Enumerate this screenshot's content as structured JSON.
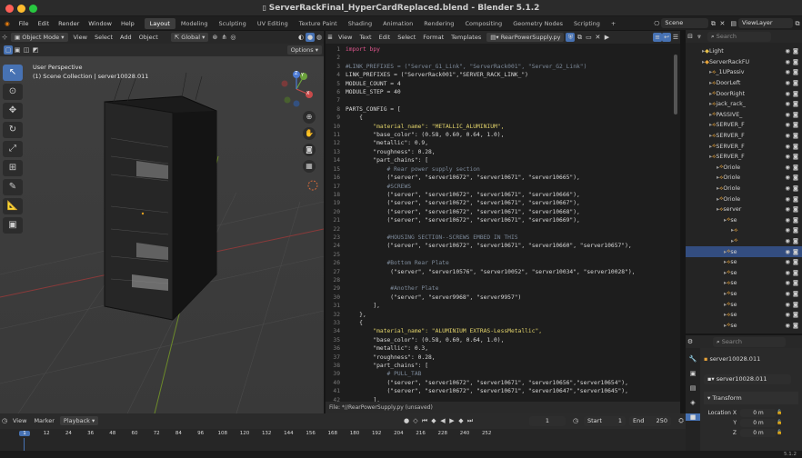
{
  "window": {
    "title": "ServerRackFinal_HyperCardReplaced.blend - Blender 5.1.2"
  },
  "menu": [
    "File",
    "Edit",
    "Render",
    "Window",
    "Help"
  ],
  "workspaces": [
    "Layout",
    "Modeling",
    "Sculpting",
    "UV Editing",
    "Texture Paint",
    "Shading",
    "Animation",
    "Rendering",
    "Compositing",
    "Geometry Nodes",
    "Scripting"
  ],
  "workspace_add": "+",
  "scene": {
    "name": "Scene",
    "view_layer": "ViewLayer"
  },
  "viewport": {
    "mode": "Object Mode",
    "menus": [
      "View",
      "Select",
      "Add",
      "Object"
    ],
    "orientation": "Global",
    "options": "Options",
    "info_line1": "User Perspective",
    "info_line2": "(1) Scene Collection | server10028.011",
    "gizmo": {
      "x": "X",
      "y": "Y",
      "z": "Z"
    }
  },
  "text_editor": {
    "menus": [
      "View",
      "Text",
      "Edit",
      "Select",
      "Format",
      "Templates"
    ],
    "filename": "RearPowerSupply.py",
    "status": "File: *//RearPowerSupply.py (unsaved)",
    "lines": [
      {
        "n": "1",
        "t": "import bpy"
      },
      {
        "n": "2",
        "t": ""
      },
      {
        "n": "3",
        "t": "#LINK_PREFIXES = (\"Server_G1_Link\", \"ServerRack001\", \"Server_G2_Link\")"
      },
      {
        "n": "4",
        "t": "LINK_PREFIXES = (\"ServerRack001\",\"SERVER_RACK_LINK_\")"
      },
      {
        "n": "5",
        "t": "MODULE_COUNT = 4"
      },
      {
        "n": "6",
        "t": "MODULE_STEP = 40"
      },
      {
        "n": "7",
        "t": ""
      },
      {
        "n": "8",
        "t": "PARTS_CONFIG = ["
      },
      {
        "n": "9",
        "t": "    {"
      },
      {
        "n": "10",
        "t": "        \"material_name\": \"METALLIC_ALUMINIUM\","
      },
      {
        "n": "11",
        "t": "        \"base_color\": (0.58, 0.60, 0.64, 1.0),"
      },
      {
        "n": "12",
        "t": "        \"metallic\": 0.9,"
      },
      {
        "n": "13",
        "t": "        \"roughness\": 0.28,"
      },
      {
        "n": "14",
        "t": "        \"part_chains\": ["
      },
      {
        "n": "15",
        "t": "            # Rear power supply section"
      },
      {
        "n": "16",
        "t": "            (\"server\", \"server10672\", \"server10671\", \"server10665\"),"
      },
      {
        "n": "17",
        "t": "            #SCREWS"
      },
      {
        "n": "18",
        "t": "            (\"server\", \"server10672\", \"server10671\", \"server10666\"),"
      },
      {
        "n": "19",
        "t": "            (\"server\", \"server10672\", \"server10671\", \"server10667\"),"
      },
      {
        "n": "20",
        "t": "            (\"server\", \"server10672\", \"server10671\", \"server10668\"),"
      },
      {
        "n": "21",
        "t": "            (\"server\", \"server10672\", \"server10671\", \"server10669\"),"
      },
      {
        "n": "22",
        "t": ""
      },
      {
        "n": "23",
        "t": "            #HOUSING SECTION--SCREWS EMBED IN THIS"
      },
      {
        "n": "24",
        "t": "            (\"server\", \"server10672\", \"server10671\", \"server10660\", \"server10657\"),"
      },
      {
        "n": "25",
        "t": ""
      },
      {
        "n": "26",
        "t": "            #Bottom Rear Plate"
      },
      {
        "n": "27",
        "t": "             (\"server\", \"server10576\", \"server10052\", \"server10034\", \"server10028\"),"
      },
      {
        "n": "28",
        "t": ""
      },
      {
        "n": "29",
        "t": "             #Another Plate"
      },
      {
        "n": "30",
        "t": "             (\"server\", \"server9968\", \"server9957\")"
      },
      {
        "n": "31",
        "t": "        ],"
      },
      {
        "n": "32",
        "t": "    },"
      },
      {
        "n": "33",
        "t": "    {"
      },
      {
        "n": "34",
        "t": "        \"material_name\": \"ALUMINIUM EXTRAS-LessMetallic\","
      },
      {
        "n": "35",
        "t": "        \"base_color\": (0.58, 0.60, 0.64, 1.0),"
      },
      {
        "n": "36",
        "t": "        \"metallic\": 0.3,"
      },
      {
        "n": "37",
        "t": "        \"roughness\": 0.28,"
      },
      {
        "n": "38",
        "t": "        \"part_chains\": ["
      },
      {
        "n": "39",
        "t": "            # PULL_TAB"
      },
      {
        "n": "40",
        "t": "            (\"server\", \"server10672\", \"server10671\", \"server10656\",\"server10654\"),"
      },
      {
        "n": "41",
        "t": "            (\"server\", \"server10672\", \"server10671\", \"server10647\",\"server10645\"),"
      },
      {
        "n": "42",
        "t": "        ],"
      },
      {
        "n": "43",
        "t": "    },"
      }
    ]
  },
  "outliner": {
    "search_placeholder": "Search",
    "items": [
      {
        "label": "Light",
        "indent": 1
      },
      {
        "label": "ServerRackFU",
        "indent": 1
      },
      {
        "label": "_1UPassiv",
        "indent": 2
      },
      {
        "label": "DoorLeft",
        "indent": 2
      },
      {
        "label": "DoorRight",
        "indent": 2
      },
      {
        "label": "jack_rack_",
        "indent": 2
      },
      {
        "label": "PASSIVE_",
        "indent": 2
      },
      {
        "label": "SERVER_F",
        "indent": 2
      },
      {
        "label": "SERVER_F",
        "indent": 2
      },
      {
        "label": "SERVER_F",
        "indent": 2
      },
      {
        "label": "SERVER_F",
        "indent": 2
      },
      {
        "label": "Oriole",
        "indent": 3
      },
      {
        "label": "Oriole",
        "indent": 3
      },
      {
        "label": "Oriole",
        "indent": 3
      },
      {
        "label": "Oriole",
        "indent": 3
      },
      {
        "label": "server",
        "indent": 3
      },
      {
        "label": "se",
        "indent": 4
      },
      {
        "label": "",
        "indent": 5
      },
      {
        "label": "",
        "indent": 5
      },
      {
        "label": "se",
        "indent": 4
      },
      {
        "label": "se",
        "indent": 4
      },
      {
        "label": "se",
        "indent": 4
      },
      {
        "label": "se",
        "indent": 4
      },
      {
        "label": "se",
        "indent": 4
      },
      {
        "label": "se",
        "indent": 4
      },
      {
        "label": "se",
        "indent": 4
      },
      {
        "label": "se",
        "indent": 4
      }
    ]
  },
  "properties": {
    "search_placeholder": "Search",
    "object_name": "server10028.011",
    "data_name": "server10028.011",
    "panel": "Transform",
    "location_label": "Location",
    "fields": [
      {
        "axis": "X",
        "value": "0 m"
      },
      {
        "axis": "Y",
        "value": "0 m"
      },
      {
        "axis": "Z",
        "value": "0 m"
      }
    ]
  },
  "timeline": {
    "menus": [
      "View",
      "Marker",
      "Playback"
    ],
    "current_frame": "1",
    "start_label": "Start",
    "start": "1",
    "end_label": "End",
    "end": "250",
    "ticks": [
      "1",
      "12",
      "24",
      "36",
      "48",
      "60",
      "72",
      "84",
      "96",
      "108",
      "120",
      "132",
      "144",
      "156",
      "168",
      "180",
      "192",
      "204",
      "216",
      "228",
      "240",
      "252"
    ]
  },
  "version": "5.1.2"
}
